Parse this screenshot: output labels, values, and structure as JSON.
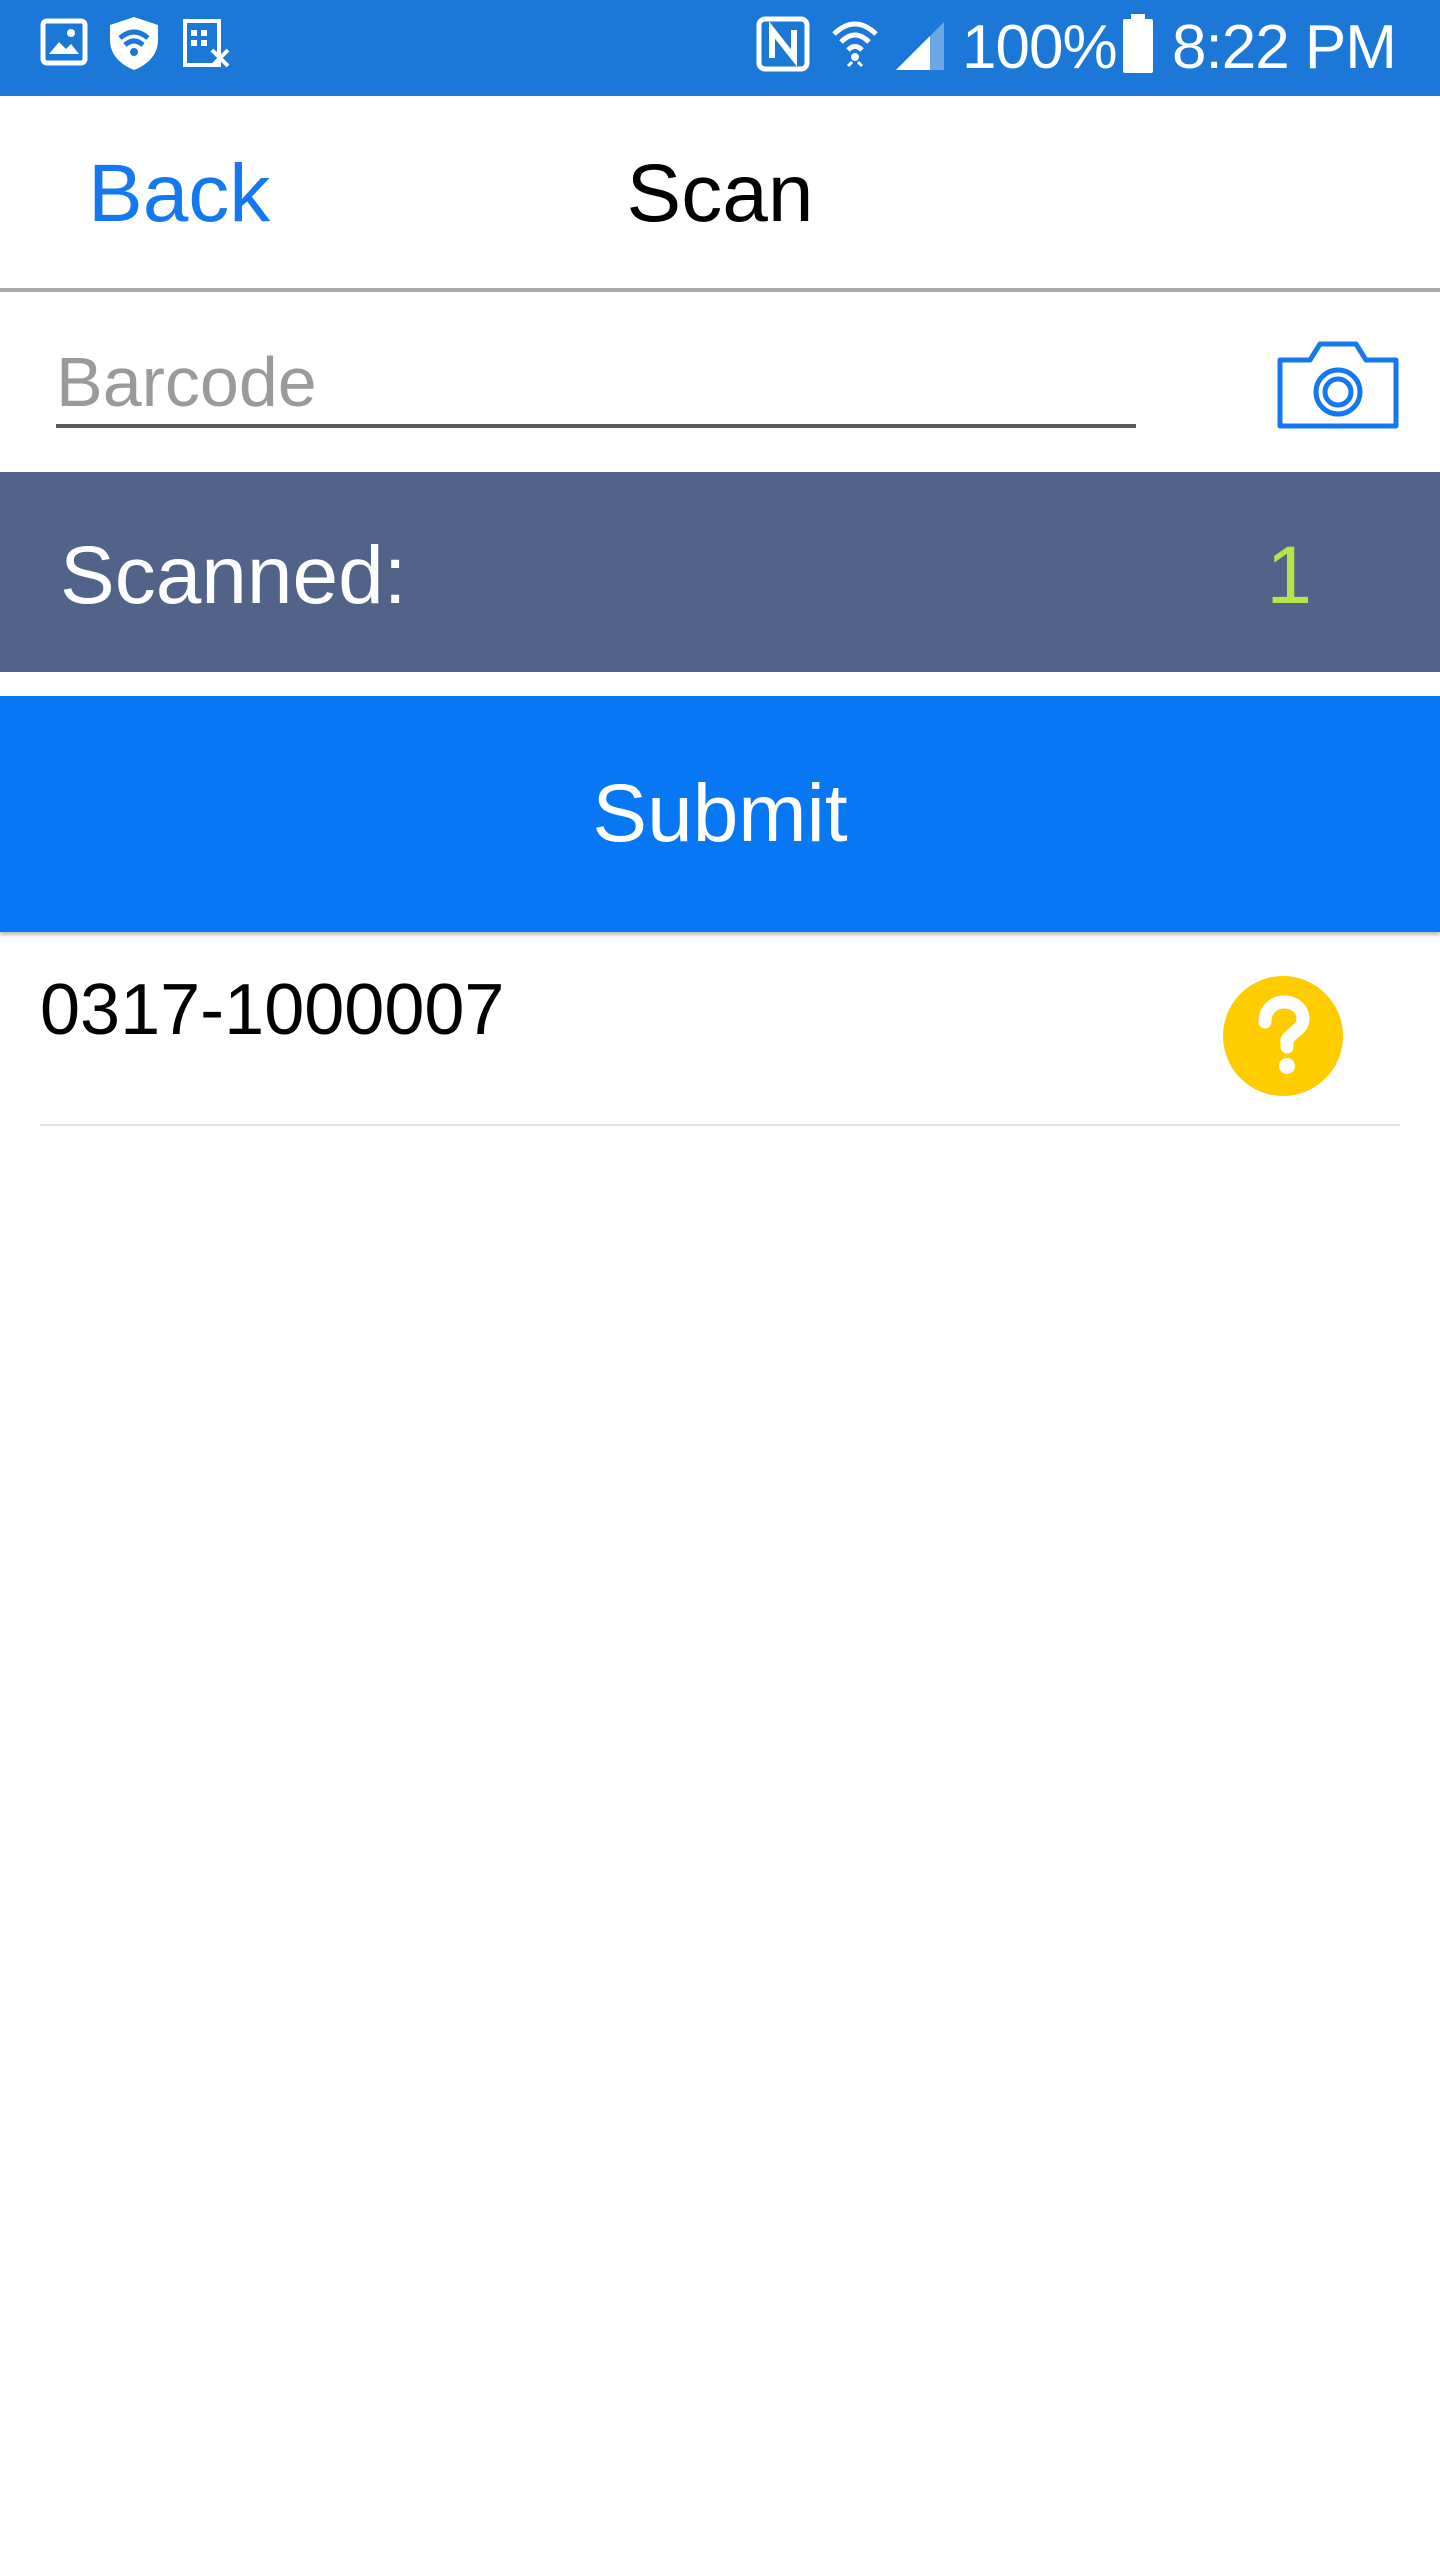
{
  "status_bar": {
    "battery_percent": "100%",
    "time": "8:22 PM",
    "icons": [
      "image-icon",
      "shield-wifi-icon",
      "sim-calendar-icon",
      "nfc-icon",
      "wifi-icon",
      "signal-icon",
      "battery-icon"
    ]
  },
  "nav": {
    "back_label": "Back",
    "title": "Scan"
  },
  "barcode": {
    "placeholder": "Barcode",
    "value": ""
  },
  "scanned": {
    "label": "Scanned:",
    "count": "1"
  },
  "submit_label": "Submit",
  "items": [
    {
      "code": "0317-1000007",
      "status_icon": "question-icon"
    }
  ],
  "colors": {
    "status_bar": "#1c78d6",
    "accent": "#1479f0",
    "scanned_bar": "#516389",
    "count": "#b3e64a",
    "submit": "#0877f4",
    "help_badge": "#ffcc00"
  }
}
